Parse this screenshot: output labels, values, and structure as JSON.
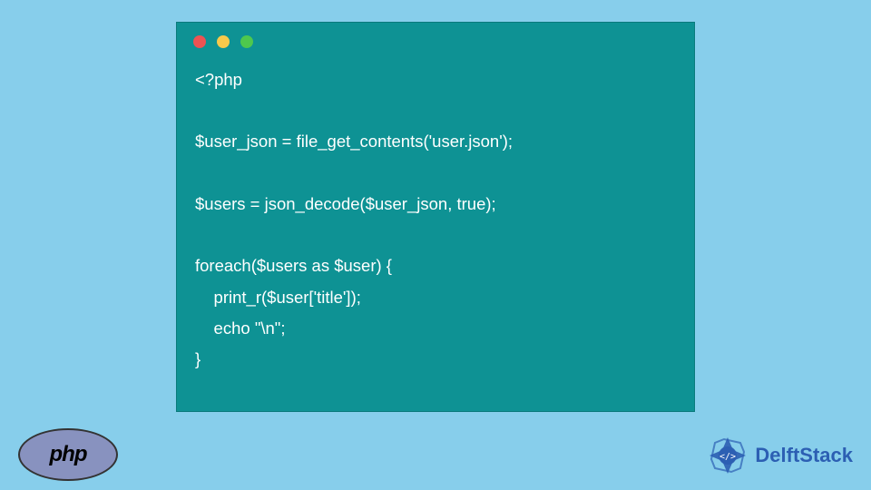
{
  "code": {
    "lines": [
      "<?php",
      "",
      "$user_json = file_get_contents('user.json');",
      "",
      "$users = json_decode($user_json, true);",
      "",
      "foreach($users as $user) {",
      "    print_r($user['title']);",
      "    echo \"\\n\";",
      "}"
    ]
  },
  "logos": {
    "php": "php",
    "delftstack": "DelftStack"
  }
}
